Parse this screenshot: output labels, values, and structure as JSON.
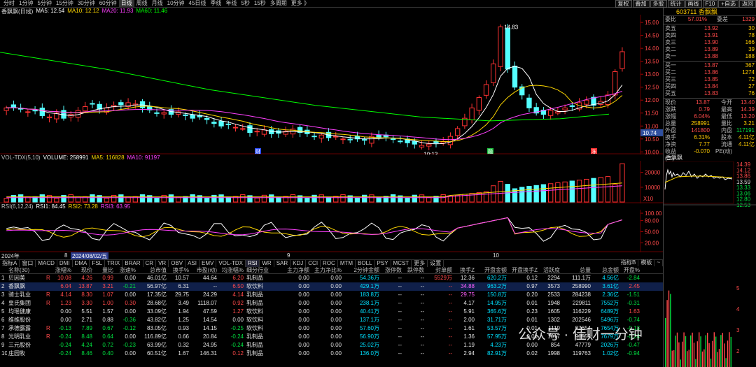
{
  "topbar": {
    "periods": [
      "分时",
      "1分钟",
      "5分钟",
      "15分钟",
      "30分钟",
      "60分钟",
      "日线",
      "周线",
      "月线",
      "10分钟",
      "45日线",
      "季线",
      "年线",
      "5秒",
      "15秒",
      "多周期",
      "更多 》"
    ],
    "active_period": 6,
    "right_buttons": [
      "复权",
      "叠加",
      "多股",
      "统计",
      "画线",
      "F10",
      "+自选",
      "返回"
    ]
  },
  "main": {
    "stock_label": "香飘飘(日线)",
    "ma": [
      {
        "label": "MA5: 12.54",
        "color": "#ffffff"
      },
      {
        "label": "MA10: 12.12",
        "color": "#ffd800"
      },
      {
        "label": "MA20: 11.93",
        "color": "#ff40ff"
      },
      {
        "label": "MA60: 11.46",
        "color": "#00ff00"
      }
    ],
    "price_ticks": [
      "15.00",
      "14.50",
      "14.00",
      "13.50",
      "13.00",
      "12.50",
      "12.00",
      "11.50",
      "11.00",
      "10.50",
      "10.00"
    ],
    "high_label": "14.83",
    "low_label": "10:13",
    "last_price_tag": "10.74",
    "event_markers": [
      "财",
      "融",
      "冻"
    ],
    "colors": {
      "up": "#ff3232",
      "down": "#54ffff",
      "bg": "#000000"
    }
  },
  "volume": {
    "legend": [
      {
        "label": "VOL-TDX(5,10)",
        "color": "#c0c0c0"
      },
      {
        "label": "VOLUME: 258991",
        "color": "#ffffff"
      },
      {
        "label": "MA5: 116828",
        "color": "#ffd800"
      },
      {
        "label": "MA10: 91197",
        "color": "#ff40ff"
      }
    ],
    "ticks": [
      "20000",
      "10000"
    ],
    "unit": "X10"
  },
  "rsi": {
    "legend": [
      {
        "label": "RSI(6,12,24)",
        "color": "#c0c0c0"
      },
      {
        "label": "RSI1: 84.45",
        "color": "#ffffff"
      },
      {
        "label": "RSI2: 73.28",
        "color": "#ffd800"
      },
      {
        "label": "RSI3: 63.95",
        "color": "#ff40ff"
      }
    ],
    "ticks": [
      "100.00",
      "80.00",
      "50.00",
      "20.00"
    ]
  },
  "datebar": {
    "labels": [
      "2024年",
      "8",
      "2024/08/02/五",
      "9",
      "10"
    ]
  },
  "indicator_tabs": [
    "指标A",
    "窗口",
    "MACD",
    "DMI",
    "DMA",
    "FSL",
    "TRIX",
    "BRAR",
    "CR",
    "VR",
    "OBV",
    "ASI",
    "EMV",
    "VOL-TDX",
    "RSI",
    "WR",
    "SAR",
    "KDJ",
    "CCI",
    "ROC",
    "MTM",
    "BOLL",
    "PSY",
    "MCST",
    "更多",
    "设置"
  ],
  "indicator_active": 14,
  "indicator_right": [
    "指标B",
    "模板",
    "~"
  ],
  "quote": {
    "title": "603711 香飘飘",
    "ratio": {
      "label1": "委比",
      "v1": "57.01%",
      "label2": "委差",
      "v2": "1329"
    },
    "asks": [
      {
        "name": "卖五",
        "price": "13.92",
        "vol": "30"
      },
      {
        "name": "卖四",
        "price": "13.91",
        "vol": "78"
      },
      {
        "name": "卖三",
        "price": "13.90",
        "vol": "166"
      },
      {
        "name": "卖二",
        "price": "13.89",
        "vol": "39"
      },
      {
        "name": "卖一",
        "price": "13.88",
        "vol": "188"
      }
    ],
    "bids": [
      {
        "name": "买一",
        "price": "13.87",
        "vol": "367"
      },
      {
        "name": "买二",
        "price": "13.86",
        "vol": "1274"
      },
      {
        "name": "买三",
        "price": "13.85",
        "vol": "72"
      },
      {
        "name": "买四",
        "price": "13.84",
        "vol": "27"
      },
      {
        "name": "买五",
        "price": "13.83",
        "vol": "76"
      }
    ],
    "stats": [
      [
        "现价",
        "13.87",
        "今开",
        "13.40"
      ],
      [
        "涨跌",
        "0.79",
        "最高",
        "14.39"
      ],
      [
        "涨幅",
        "6.04%",
        "最低",
        "13.20"
      ],
      [
        "总量",
        "258991",
        "量比",
        "3.21"
      ],
      [
        "外盘",
        "141800",
        "内盘",
        "117191"
      ],
      [
        "换手",
        "6.31%",
        "股本",
        "4.11亿"
      ],
      [
        "净资",
        "7.77",
        "流通",
        "4.11亿"
      ],
      [
        "收益(二)",
        "-0.070",
        "PE(动)",
        ""
      ]
    ]
  },
  "mini": {
    "title": "香飘飘",
    "ticks": [
      "14.39",
      "14.12",
      "13.86",
      "13.59",
      "13.33",
      "13.06",
      "12.80",
      "12.53"
    ],
    "vol_ticks": [
      "5",
      "4",
      "3",
      "2"
    ]
  },
  "table": {
    "headers": [
      "",
      "名称(30)",
      "",
      "涨幅%",
      "现价",
      "量比",
      "涨速%",
      "总市值",
      "换手%",
      "市盈(动)",
      "均涨幅%",
      "细分行业",
      "主力净额",
      "主力净比%",
      "2分钟金额",
      "涨停数",
      "跌停数",
      "封单额",
      "换手Z",
      "开盘金额",
      "开盘换手Z",
      "活跃度",
      "总量",
      "总金额",
      "开盘%"
    ],
    "rows": [
      [
        "1",
        "贝因美",
        "R",
        "10.08",
        "4.26",
        "0.99",
        "0.00",
        "46.01亿",
        "10.57",
        "44.64",
        "6.20",
        "乳制品",
        "0.00",
        "0.00",
        "54.36万",
        "--",
        "--",
        "5529万",
        "12.36",
        "620.2万",
        "0.12",
        "2294",
        "111.1万",
        "4.56亿",
        "-2.84"
      ],
      [
        "2",
        "香飘飘",
        "",
        "6.04",
        "13.87",
        "3.21",
        "-0.21",
        "56.97亿",
        "6.31",
        "--",
        "6.50",
        "软饮料",
        "0.00",
        "0.00",
        "429.1万",
        "--",
        "--",
        "--",
        "34.88",
        "963.2万",
        "0.97",
        "3573",
        "258990",
        "3.61亿",
        "2.45"
      ],
      [
        "3",
        "骑士乳业",
        "R",
        "4.14",
        "8.30",
        "1.07",
        "0.00",
        "17.35亿",
        "29.75",
        "24.29",
        "4.14",
        "乳制品",
        "0.00",
        "0.00",
        "183.8万",
        "--",
        "--",
        "--",
        "29.75",
        "150.8万",
        "0.20",
        "2533",
        "284238",
        "2.36亿",
        "-1.51"
      ],
      [
        "4",
        "皇氏集团",
        "R",
        "1.23",
        "3.30",
        "1.00",
        "0.30",
        "28.68亿",
        "3.49",
        "1118.07",
        "0.92",
        "乳制品",
        "0.00",
        "0.00",
        "238.1万",
        "--",
        "--",
        "--",
        "4.17",
        "14.95万",
        "0.01",
        "1948",
        "229811",
        "7552万",
        "-0.31"
      ],
      [
        "5",
        "均瑶健康",
        "",
        "0.00",
        "5.51",
        "1.57",
        "0.00",
        "33.09亿",
        "1.94",
        "47.59",
        "1.27",
        "软饮料",
        "0.00",
        "0.00",
        "40.41万",
        "--",
        "--",
        "--",
        "5.91",
        "365.6万",
        "0.23",
        "1605",
        "116229",
        "6489万",
        "1.63"
      ],
      [
        "6",
        "维维股份",
        "",
        "0.00",
        "2.71",
        "0.88",
        "-0.36",
        "43.82亿",
        "1.25",
        "14.54",
        "0.00",
        "软饮料",
        "0.00",
        "0.00",
        "137.1万",
        "--",
        "--",
        "--",
        "2.00",
        "31.71万",
        "0.01",
        "1302",
        "202546",
        "5496万",
        "-0.74"
      ],
      [
        "7",
        "承德露露",
        "R",
        "-0.13",
        "7.89",
        "0.67",
        "-0.12",
        "83.05亿",
        "0.93",
        "14.15",
        "-0.25",
        "软饮料",
        "0.00",
        "0.00",
        "57.60万",
        "--",
        "--",
        "--",
        "1.61",
        "53.57万",
        "0.01",
        "1119",
        "97654",
        "7654万",
        "-0.13"
      ],
      [
        "8",
        "光明乳业",
        "R",
        "-0.24",
        "8.48",
        "0.64",
        "0.00",
        "116.89亿",
        "0.66",
        "20.84",
        "-0.24",
        "乳制品",
        "0.00",
        "0.00",
        "56.90万",
        "--",
        "--",
        "--",
        "1.36",
        "57.95万",
        "0.01",
        "1017",
        "90559",
        "7679万",
        "-0.24"
      ],
      [
        "9",
        "三元股份",
        "",
        "-0.24",
        "4.24",
        "0.72",
        "-0.23",
        "63.99亿",
        "0.32",
        "24.95",
        "-0.24",
        "乳制品",
        "0.00",
        "0.00",
        "25.02万",
        "--",
        "--",
        "--",
        "1.19",
        "4.23万",
        "0.00",
        "854",
        "47779",
        "2026万",
        "-0.47"
      ],
      [
        "10",
        "庄园牧",
        "",
        "-0.24",
        "8.46",
        "0.40",
        "0.00",
        "60.51亿",
        "1.67",
        "146.31",
        "0.12",
        "乳制品",
        "0.00",
        "0.00",
        "136.0万",
        "--",
        "--",
        "--",
        "2.94",
        "82.91万",
        "0.02",
        "1998",
        "119763",
        "1.02亿",
        "-0.94"
      ]
    ]
  },
  "watermark": "公众号 · 佳财一分钟"
}
